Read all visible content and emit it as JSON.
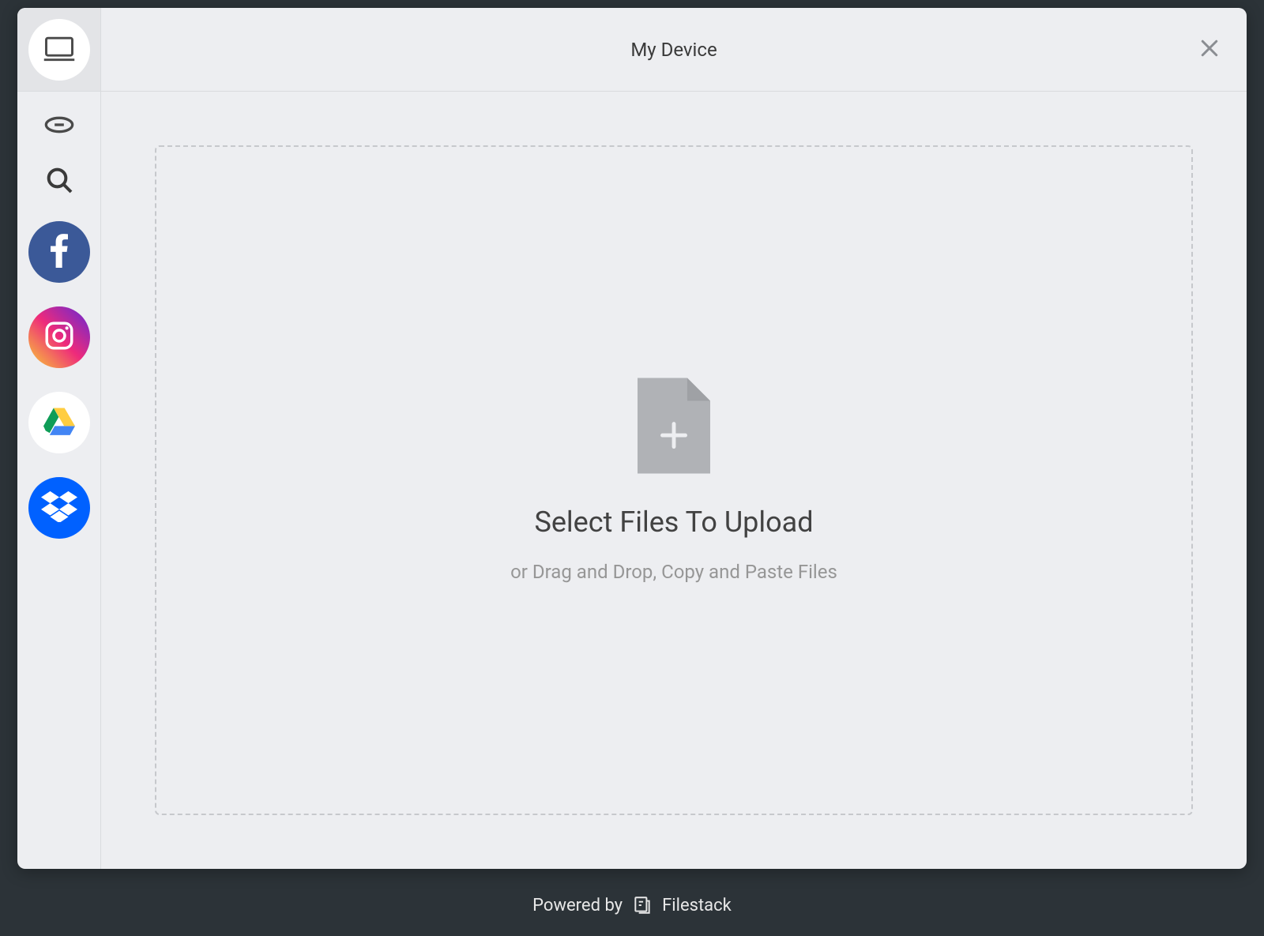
{
  "header": {
    "title": "My Device"
  },
  "sidebar": {
    "items": [
      {
        "name": "my-device",
        "label": "My Device"
      },
      {
        "name": "link",
        "label": "Link (URL)"
      },
      {
        "name": "search",
        "label": "Web Search"
      },
      {
        "name": "facebook",
        "label": "Facebook"
      },
      {
        "name": "instagram",
        "label": "Instagram"
      },
      {
        "name": "google-drive",
        "label": "Google Drive"
      },
      {
        "name": "dropbox",
        "label": "Dropbox"
      }
    ]
  },
  "dropzone": {
    "title": "Select Files To Upload",
    "subtitle": "or Drag and Drop, Copy and Paste Files"
  },
  "footer": {
    "powered_by": "Powered by",
    "brand": "Filestack"
  }
}
